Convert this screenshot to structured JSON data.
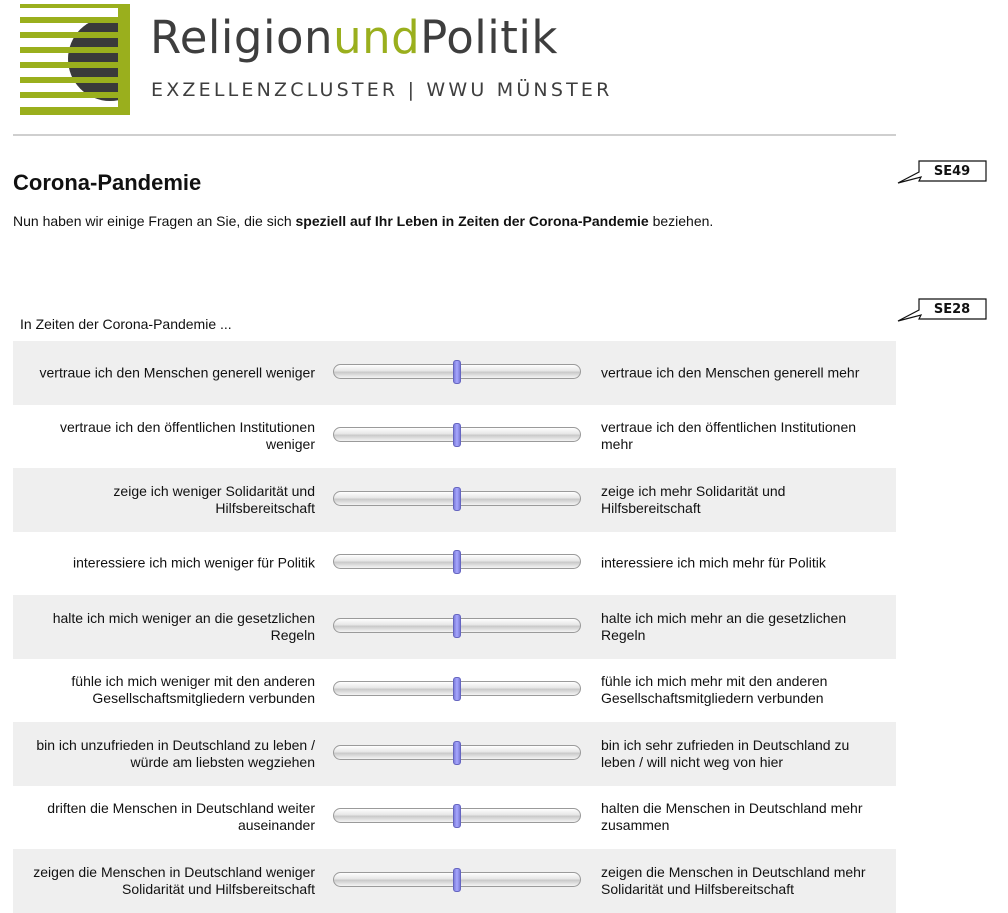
{
  "header": {
    "logo_title_part1": "Religion",
    "logo_title_part2": "und",
    "logo_title_part3": "Politik",
    "logo_subtitle": "EXZELLENZCLUSTER | WWU MÜNSTER",
    "accent_color": "#9aaf1d",
    "logo_icon": "striped-circle-logo-icon"
  },
  "section": {
    "code": "SE49",
    "title": "Corona-Pandemie",
    "intro_before": "Nun haben wir einige Fragen an Sie, die sich ",
    "intro_bold": "speziell auf Ihr Leben in Zeiten der Corona-Pandemie",
    "intro_after": " beziehen."
  },
  "question": {
    "code": "SE28",
    "stem": "In Zeiten der Corona-Pandemie ...",
    "items": [
      {
        "left": "vertraue ich den Menschen generell weniger",
        "right": "vertraue ich den Menschen generell mehr",
        "value": 0.5
      },
      {
        "left": "vertraue ich den öffentlichen Institutionen weniger",
        "right": "vertraue ich den öffentlichen Institutionen mehr",
        "value": 0.5
      },
      {
        "left": "zeige ich weniger Solidarität und Hilfsbereitschaft",
        "right": "zeige ich mehr Solidarität und Hilfsbereitschaft",
        "value": 0.5
      },
      {
        "left": "interessiere ich mich weniger für Politik",
        "right": "interessiere ich mich mehr für Politik",
        "value": 0.5
      },
      {
        "left": "halte ich mich weniger an die gesetzlichen Regeln",
        "right": "halte ich mich mehr an die gesetzlichen Regeln",
        "value": 0.5
      },
      {
        "left": "fühle ich mich weniger mit den anderen Gesellschaftsmitgliedern verbunden",
        "right": "fühle ich mich mehr mit den anderen Gesellschaftsmitgliedern verbunden",
        "value": 0.5
      },
      {
        "left": "bin ich unzufrieden in Deutschland zu leben / würde am liebsten wegziehen",
        "right": "bin ich sehr zufrieden in Deutschland zu leben / will nicht weg von hier",
        "value": 0.5
      },
      {
        "left": "driften die Menschen in Deutschland weiter auseinander",
        "right": "halten die Menschen in Deutschland mehr zusammen",
        "value": 0.5
      },
      {
        "left": "zeigen die Menschen in Deutschland weniger Solidarität und Hilfsbereitschaft",
        "right": "zeigen die Menschen in Deutschland mehr Solidarität und Hilfsbereitschaft",
        "value": 0.5
      }
    ]
  }
}
